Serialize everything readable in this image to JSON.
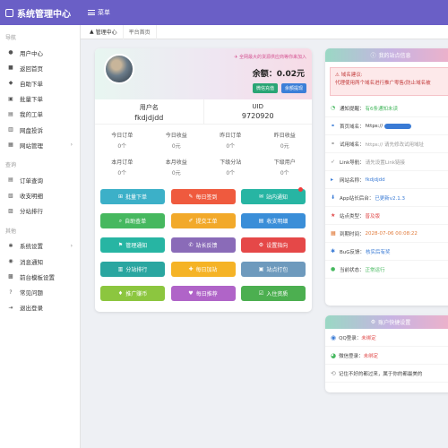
{
  "app_title": "系统管理中心",
  "menu_label": "菜单",
  "sidebar": {
    "sections": [
      {
        "title": "导航",
        "items": [
          {
            "icon": "user-icon",
            "glyph": "●",
            "label": "用户中心",
            "arrow": false
          },
          {
            "icon": "home-icon",
            "glyph": "■",
            "label": "返回首页",
            "arrow": false
          },
          {
            "icon": "cart-icon",
            "glyph": "◆",
            "label": "自助下单",
            "arrow": false
          },
          {
            "icon": "copy-icon",
            "glyph": "▣",
            "label": "批量下单",
            "arrow": false
          },
          {
            "icon": "doc-icon",
            "glyph": "▤",
            "label": "我的工单",
            "arrow": false
          },
          {
            "icon": "docs-icon",
            "glyph": "▥",
            "label": "网盘投诉",
            "arrow": false
          },
          {
            "icon": "site-icon",
            "glyph": "▦",
            "label": "网站管理",
            "arrow": true
          }
        ]
      },
      {
        "title": "查询",
        "items": [
          {
            "icon": "order-icon",
            "glyph": "▤",
            "label": "订单查询",
            "arrow": false
          },
          {
            "icon": "money-icon",
            "glyph": "▧",
            "label": "收支明细",
            "arrow": false
          },
          {
            "icon": "rank-icon",
            "glyph": "▨",
            "label": "分站排行",
            "arrow": false
          }
        ]
      },
      {
        "title": "其他",
        "items": [
          {
            "icon": "settings-icon",
            "glyph": "✱",
            "label": "系统设置",
            "arrow": true
          },
          {
            "icon": "bell-icon",
            "glyph": "◉",
            "label": "消息通知",
            "arrow": false
          },
          {
            "icon": "template-icon",
            "glyph": "▩",
            "label": "前台模板设置",
            "arrow": false
          },
          {
            "icon": "help-icon",
            "glyph": "?",
            "label": "常见问题",
            "arrow": false
          },
          {
            "icon": "logout-icon",
            "glyph": "⇥",
            "label": "退出登录",
            "arrow": false
          }
        ]
      }
    ]
  },
  "breadcrumb": {
    "home": "管理中心",
    "current": "平台首页"
  },
  "profile": {
    "notice": "全网最大的货源供应商等你来加入",
    "balance_label": "余额：",
    "balance": "0.02元",
    "recharge_btn": "微信充值",
    "withdraw_btn": "余额提现",
    "username_label": "用户名",
    "username": "fkdjdjdd",
    "uid_label": "UID",
    "uid": "9720920",
    "stats": [
      {
        "label": "今日订单",
        "value": "0个"
      },
      {
        "label": "今日收益",
        "value": "0元"
      },
      {
        "label": "昨日订单",
        "value": "0个"
      },
      {
        "label": "昨日收益",
        "value": "0元"
      },
      {
        "label": "本月订单",
        "value": "0个"
      },
      {
        "label": "本月收益",
        "value": "0元"
      },
      {
        "label": "下级分站",
        "value": "0个"
      },
      {
        "label": "下级用户",
        "value": "0个"
      }
    ],
    "buttons": [
      {
        "label": "批量下单",
        "color": "#3cb0c8",
        "glyph": "⊞",
        "icon": "batch-order-icon",
        "dot": false
      },
      {
        "label": "每日签到",
        "color": "#ef5a3e",
        "glyph": "✎",
        "icon": "checkin-icon",
        "dot": false
      },
      {
        "label": "站内通知",
        "color": "#27b5a3",
        "glyph": "✉",
        "icon": "notice-icon",
        "dot": true
      },
      {
        "label": "自助查单",
        "color": "#46b85f",
        "glyph": "⌕",
        "icon": "query-icon",
        "dot": false
      },
      {
        "label": "提交工单",
        "color": "#f2a92a",
        "glyph": "✐",
        "icon": "ticket-icon",
        "dot": false
      },
      {
        "label": "收支明细",
        "color": "#3a8ed8",
        "glyph": "▤",
        "icon": "ledger-icon",
        "dot": false
      },
      {
        "label": "管理通知",
        "color": "#27b5a3",
        "glyph": "⚑",
        "icon": "admin-notice-icon",
        "dot": false
      },
      {
        "label": "站长反馈",
        "color": "#8a6bb8",
        "glyph": "✆",
        "icon": "feedback-icon",
        "dot": false
      },
      {
        "label": "设置指向",
        "color": "#e54848",
        "glyph": "⚙",
        "icon": "settings-icon",
        "dot": false
      },
      {
        "label": "分站排行",
        "color": "#2aa6a0",
        "glyph": "▥",
        "icon": "rank-icon",
        "dot": false
      },
      {
        "label": "每日加站",
        "color": "#f5b326",
        "glyph": "✚",
        "icon": "add-site-icon",
        "dot": false
      },
      {
        "label": "站点打包",
        "color": "#6e9abd",
        "glyph": "▣",
        "icon": "package-icon",
        "dot": false
      },
      {
        "label": "推广赚币",
        "color": "#8cc63f",
        "glyph": "♦",
        "icon": "promote-icon",
        "dot": false
      },
      {
        "label": "每日推荐",
        "color": "#b064c8",
        "glyph": "♥",
        "icon": "recommend-icon",
        "dot": false
      },
      {
        "label": "入住资质",
        "color": "#4caf50",
        "glyph": "☑",
        "icon": "qualify-icon",
        "dot": false
      }
    ]
  },
  "site_info": {
    "header": "我的站点信息",
    "alert_title": "域名建议:",
    "alert_body": "代理使用两个域名进行推广零售(防止域名被",
    "rows": [
      {
        "icon": "clock-icon",
        "glyph": "◔",
        "label": "通知提醒：",
        "value": "有6条通知未读",
        "color": "#46b85f",
        "masked": false
      },
      {
        "icon": "link-icon",
        "glyph": "⚭",
        "label": "首页域名：",
        "value": "https://",
        "color": "#333",
        "masked": true
      },
      {
        "icon": "link-icon",
        "glyph": "⚭",
        "label": "试用域名：",
        "value": "https:// 请先修改试用域址",
        "color": "#999",
        "masked": false
      },
      {
        "icon": "share-icon",
        "glyph": "➶",
        "label": "Link导航：",
        "value": "请先设置Link链接",
        "color": "#999",
        "masked": false
      },
      {
        "icon": "tag-icon",
        "glyph": "▸",
        "label": "网站名称：",
        "value": "fkdjdjdd",
        "color": "#3a7bd5",
        "masked": false
      },
      {
        "icon": "download-icon",
        "glyph": "⬇",
        "label": "App站长后台：",
        "value": "已更新v2.1.3",
        "color": "#3a7bd5",
        "masked": false
      },
      {
        "icon": "star-icon",
        "glyph": "★",
        "label": "站点类型：",
        "value": "普及版",
        "color": "#e04a4a",
        "masked": false
      },
      {
        "icon": "calendar-icon",
        "glyph": "▦",
        "label": "到期时间：",
        "value": "2028-07-06 00:08:22",
        "color": "#e07a3a",
        "masked": false
      },
      {
        "icon": "bug-icon",
        "glyph": "✱",
        "label": "BuG反馈：",
        "value": "核实后有奖",
        "color": "#3a7bd5",
        "masked": false
      },
      {
        "icon": "status-icon",
        "glyph": "●",
        "label": "当前状态：",
        "value": "正常运行",
        "color": "#46b85f",
        "masked": false
      }
    ]
  },
  "settings_card": {
    "header": "账户快捷设置",
    "rows": [
      {
        "icon": "qq-icon",
        "glyph": "◉",
        "iconColor": "#3a7bd5",
        "label": "QQ登录：",
        "value": "未绑定"
      },
      {
        "icon": "wechat-icon",
        "glyph": "◕",
        "iconColor": "#46b85f",
        "label": "微信登录：",
        "value": "未绑定"
      },
      {
        "icon": "history-icon",
        "glyph": "⟲",
        "iconColor": "#999",
        "label": "记住不好的都过来，属于你的都最美的",
        "value": ""
      }
    ]
  }
}
